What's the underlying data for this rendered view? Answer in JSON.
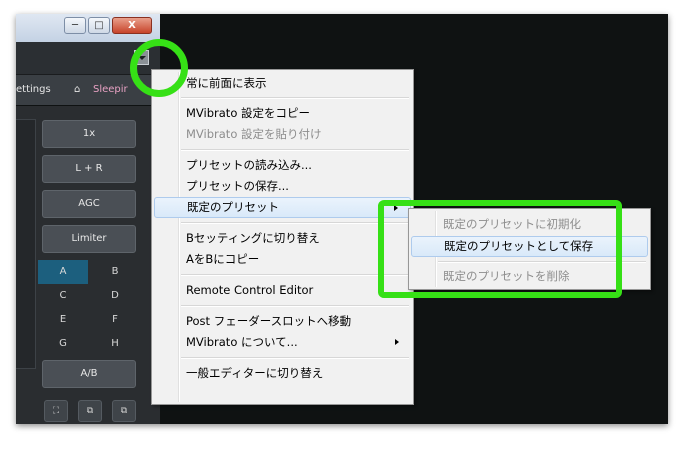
{
  "plugin": {
    "window_buttons": {
      "minimize": "─",
      "maximize": "□",
      "close": "X"
    },
    "settings_label": "ettings",
    "preset_name": "Sleepir",
    "buttons": [
      "1x",
      "L + R",
      "AGC",
      "Limiter"
    ],
    "ab_cells": [
      "A",
      "B",
      "C",
      "D",
      "E",
      "F",
      "G",
      "H"
    ],
    "ab_button": "A/B",
    "small_icons": [
      "⛶",
      "⧉",
      "⧉"
    ],
    "colors": {
      "active_cell": "#1c5f7e",
      "annotation": "#36e016"
    }
  },
  "menu": {
    "items": [
      {
        "label": "常に前面に表示"
      },
      {
        "label": "MVibrato 設定をコピー"
      },
      {
        "label": "MVibrato 設定を貼り付け",
        "state": "disabled"
      },
      {
        "label": "プリセットの読み込み..."
      },
      {
        "label": "プリセットの保存..."
      },
      {
        "label": "既定のプリセット",
        "state": "highlighted",
        "submenu": true
      },
      {
        "label": "Bセッティングに切り替え"
      },
      {
        "label": "AをBにコピー"
      },
      {
        "label": "Remote Control Editor"
      },
      {
        "label": "Post フェーダースロットへ移動"
      },
      {
        "label": "MVibrato について...",
        "submenu": true
      },
      {
        "label": "一般エディターに切り替え"
      }
    ]
  },
  "submenu": {
    "items": [
      {
        "label": "既定のプリセットに初期化",
        "state": "disabled"
      },
      {
        "label": "既定のプリセットとして保存",
        "state": "highlighted"
      },
      {
        "label": "既定のプリセットを削除",
        "state": "disabled"
      }
    ]
  }
}
